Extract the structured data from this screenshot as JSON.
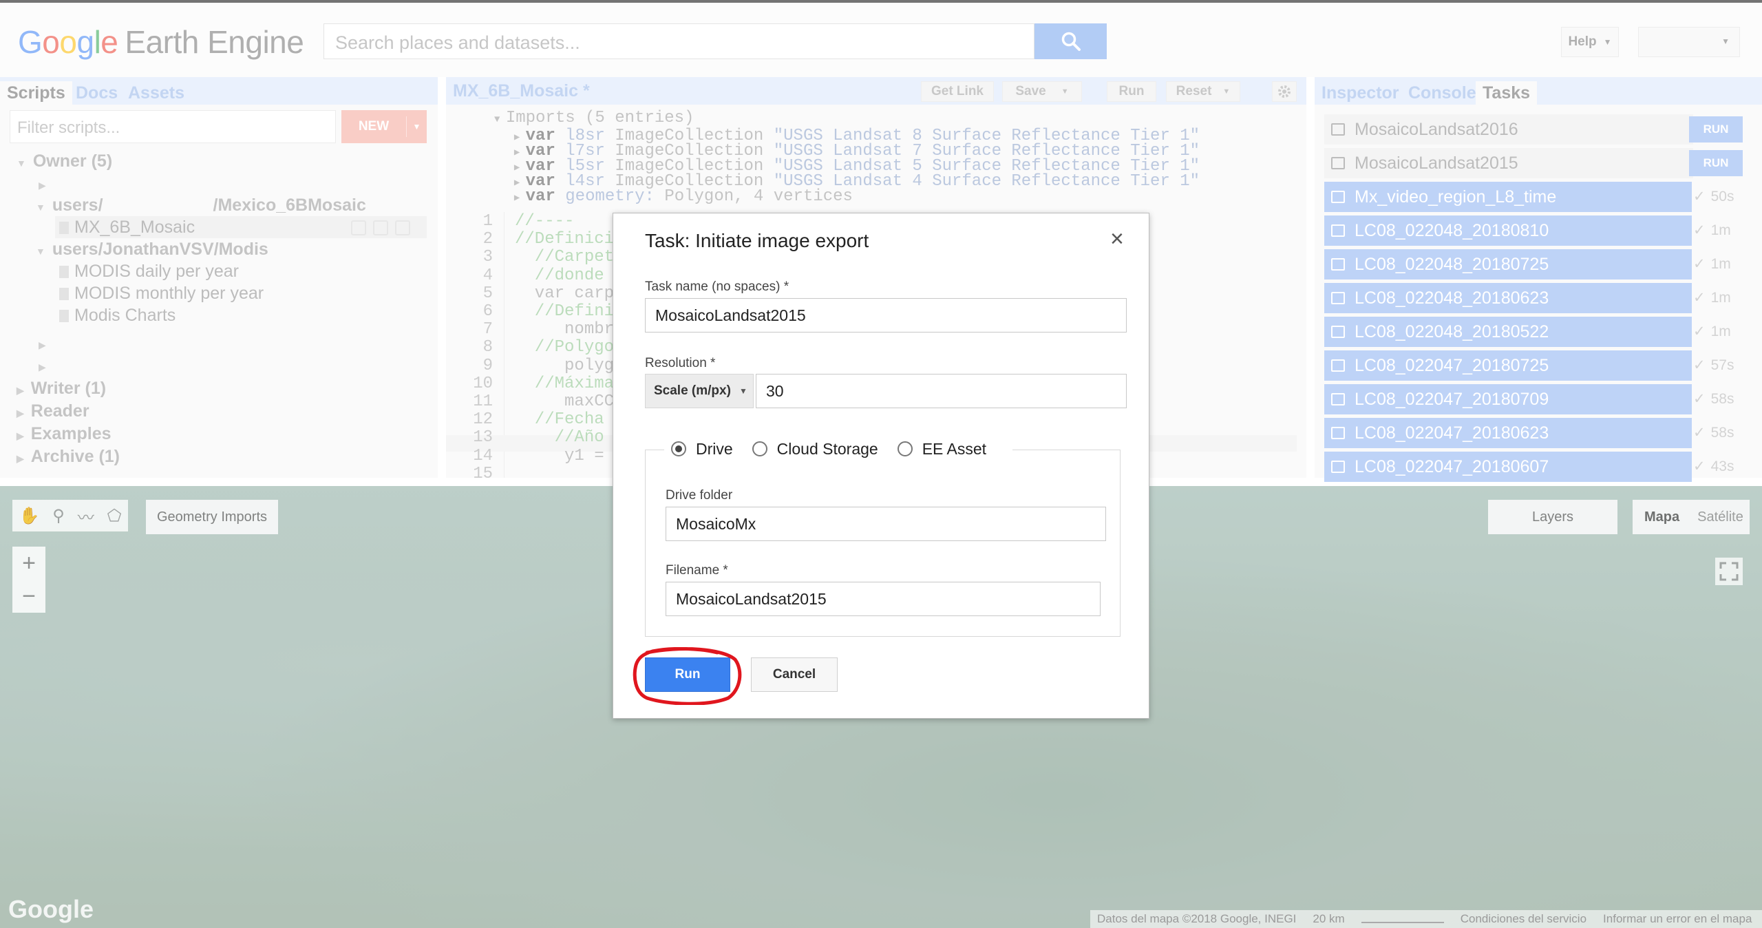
{
  "header": {
    "logo_google": [
      "G",
      "o",
      "o",
      "g",
      "l",
      "e"
    ],
    "logo_rest": "Earth Engine",
    "search_placeholder": "Search places and datasets...",
    "help_label": "Help"
  },
  "left_panel": {
    "tabs": [
      "Scripts",
      "Docs",
      "Assets"
    ],
    "filter_placeholder": "Filter scripts...",
    "new_button": "NEW",
    "tree": {
      "owner": "Owner (5)",
      "users_prefix": "users/",
      "users_suffix": "/Mexico_6BMosaic",
      "mosaic_file": "MX_6B_Mosaic",
      "modis_folder": "users/JonathanVSV/Modis",
      "modis_files": [
        "MODIS daily per year",
        "MODIS monthly per year",
        "Modis Charts"
      ],
      "writer": "Writer (1)",
      "reader": "Reader",
      "examples": "Examples",
      "archive": "Archive (1)"
    }
  },
  "editor": {
    "title": "MX_6B_Mosaic *",
    "buttons": {
      "get_link": "Get Link",
      "save": "Save",
      "run": "Run",
      "reset": "Reset"
    },
    "imports_header": "Imports (5 entries)",
    "imports": [
      {
        "kw": "var",
        "name": "l8sr",
        "type": "ImageCollection",
        "value": "\"USGS Landsat 8 Surface Reflectance Tier 1\""
      },
      {
        "kw": "var",
        "name": "l7sr",
        "type": "ImageCollection",
        "value": "\"USGS Landsat 7 Surface Reflectance Tier 1\""
      },
      {
        "kw": "var",
        "name": "l5sr",
        "type": "ImageCollection",
        "value": "\"USGS Landsat 5 Surface Reflectance Tier 1\""
      },
      {
        "kw": "var",
        "name": "l4sr",
        "type": "ImageCollection",
        "value": "\"USGS Landsat 4 Surface Reflectance Tier 1\""
      },
      {
        "kw": "var",
        "name": "geometry:",
        "type": "Polygon, 4 vertices",
        "value": ""
      }
    ],
    "line_numbers": [
      "1",
      "2",
      "3",
      "4",
      "5",
      "6",
      "7",
      "8",
      "9",
      "10",
      "11",
      "12",
      "13",
      "14",
      "15"
    ],
    "lines": [
      "//----",
      "//Definicio",
      "  //Carpeta",
      "  //donde v",
      "  var carpe",
      "  //Definir",
      "     nombr",
      "  //Polygon",
      "     polyg",
      "  //Máxima",
      "     maxCC",
      "  //Fecha d",
      "    //Año i",
      "     y1 =",
      ""
    ],
    "line_right_fragment": "--------------"
  },
  "tasks_panel": {
    "tabs": [
      "Inspector",
      "Console",
      "Tasks"
    ],
    "pending": [
      {
        "name": "MosaicoLandsat2016",
        "action": "RUN"
      },
      {
        "name": "MosaicoLandsat2015",
        "action": "RUN"
      }
    ],
    "completed": [
      {
        "name": "Mx_video_region_L8_time",
        "duration": "50s"
      },
      {
        "name": "LC08_022048_20180810",
        "duration": "1m"
      },
      {
        "name": "LC08_022048_20180725",
        "duration": "1m"
      },
      {
        "name": "LC08_022048_20180623",
        "duration": "1m"
      },
      {
        "name": "LC08_022048_20180522",
        "duration": "1m"
      },
      {
        "name": "LC08_022047_20180725",
        "duration": "57s"
      },
      {
        "name": "LC08_022047_20180709",
        "duration": "58s"
      },
      {
        "name": "LC08_022047_20180623",
        "duration": "58s"
      },
      {
        "name": "LC08_022047_20180607",
        "duration": "43s"
      }
    ]
  },
  "map": {
    "geometry_imports": "Geometry Imports",
    "zoom_in": "+",
    "zoom_out": "−",
    "layers": "Layers",
    "map_type": [
      "Mapa",
      "Satélite"
    ],
    "google_logo": "Google",
    "attribution": [
      "Datos del mapa ©2018 Google, INEGI",
      "20 km",
      "Condiciones del servicio",
      "Informar un error en el mapa"
    ]
  },
  "modal": {
    "title": "Task: Initiate image export",
    "close": "×",
    "task_name_label": "Task name (no spaces) *",
    "task_name_value": "MosaicoLandsat2015",
    "resolution_label": "Resolution *",
    "scale_option": "Scale (m/px)",
    "resolution_value": "30",
    "destinations": [
      {
        "label": "Drive",
        "selected": true
      },
      {
        "label": "Cloud Storage",
        "selected": false
      },
      {
        "label": "EE Asset",
        "selected": false
      }
    ],
    "drive_folder_label": "Drive folder",
    "drive_folder_value": "MosaicoMx",
    "filename_label": "Filename *",
    "filename_value": "MosaicoLandsat2015",
    "run_button": "Run",
    "cancel_button": "Cancel"
  },
  "colors": {
    "accent": "#3b82f0",
    "annotation": "#e0161e",
    "tasks_done": "#8fb4f2"
  }
}
